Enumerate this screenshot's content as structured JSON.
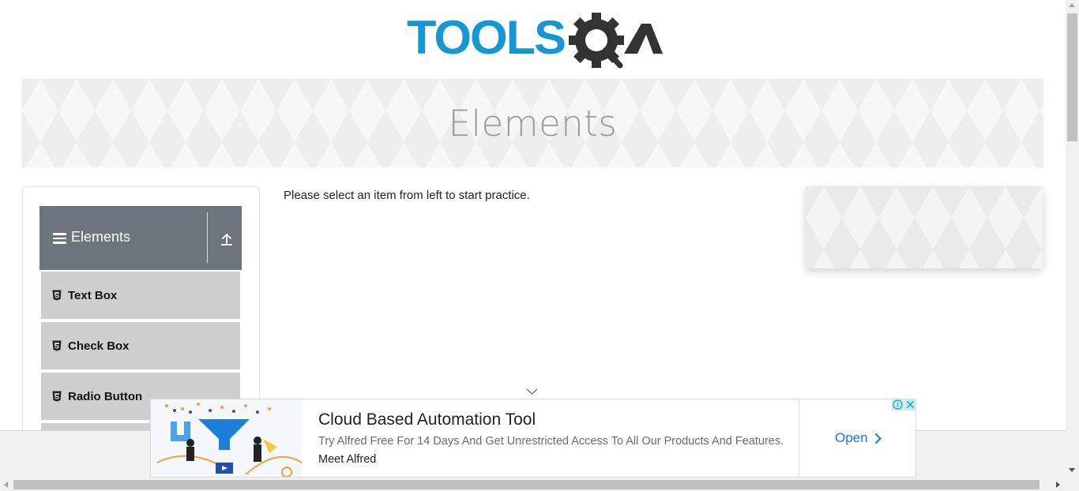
{
  "header": {
    "logo_text_part1": "TOOLS",
    "logo_text_part2": "QA",
    "logo_icon": "gear-magnifier-icon",
    "brand_blue": "#1597d5",
    "brand_dark": "#333333"
  },
  "banner": {
    "title": "Elements"
  },
  "sidebar": {
    "group": {
      "title": "Elements",
      "menu_icon": "hamburger-icon",
      "collapse_icon": "upload-arrow-icon"
    },
    "items": [
      {
        "label": "Text Box",
        "icon": "html5-icon"
      },
      {
        "label": "Check Box",
        "icon": "html5-icon"
      },
      {
        "label": "Radio Button",
        "icon": "html5-icon"
      }
    ]
  },
  "main": {
    "intro_text": "Please select an item from left to start practice."
  },
  "ad": {
    "headline": "Cloud Based Automation Tool",
    "description": "Try Alfred Free For 14 Days And Get Unrestricted Access To All Our Products And Features.",
    "brand": "Meet Alfred",
    "cta_label": "Open",
    "cta_color": "#1a73e8",
    "info_icon": "info-icon",
    "close_icon": "close-icon"
  },
  "colors": {
    "sidebar_header_bg": "#6c757d",
    "menu_item_bg": "#cfcfcf"
  }
}
